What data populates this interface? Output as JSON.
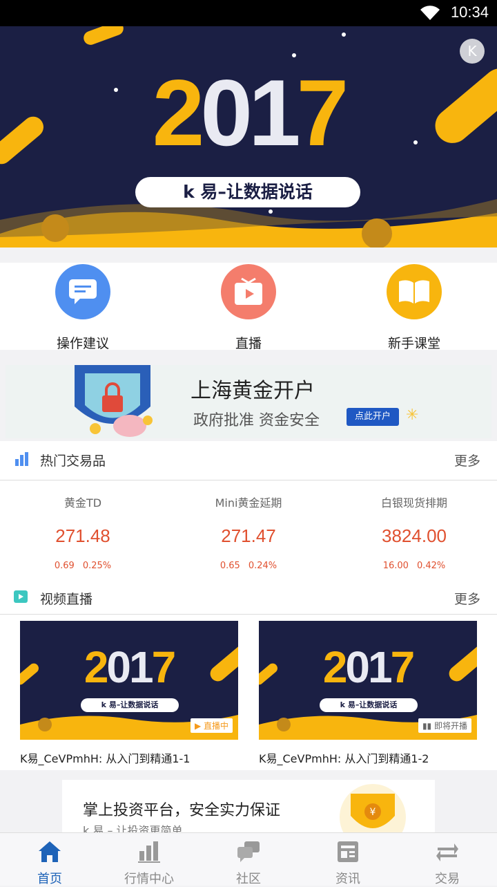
{
  "status": {
    "time": "10:34"
  },
  "hero": {
    "year_white": "20",
    "year_white2": "17",
    "slogan": "k 易–让数据说话"
  },
  "quick_actions": [
    {
      "label": "操作建议",
      "color": "#4f8ff0"
    },
    {
      "label": "直播",
      "color": "#f47d6c"
    },
    {
      "label": "新手课堂",
      "color": "#f8b50e"
    }
  ],
  "ad_banner": {
    "title": "上海黄金开户",
    "subtitle": "政府批准  资金安全",
    "button": "点此开户"
  },
  "hot": {
    "title": "热门交易品",
    "more": "更多",
    "items": [
      {
        "name": "黄金TD",
        "price": "271.48",
        "change": "0.69",
        "percent": "0.25%"
      },
      {
        "name": "Mini黄金延期",
        "price": "271.47",
        "change": "0.65",
        "percent": "0.24%"
      },
      {
        "name": "白银现货排期",
        "price": "3824.00",
        "change": "16.00",
        "percent": "0.42%"
      }
    ]
  },
  "videos": {
    "title": "视频直播",
    "more": "更多",
    "items": [
      {
        "title": "K易_CeVPmhH: 从入门到精通1-1",
        "badge": "直播中",
        "pill": "k 易–让数据说话"
      },
      {
        "title": "K易_CeVPmhH: 从入门到精通1-2",
        "badge": "即将开播",
        "pill": "k 易–让数据说话"
      }
    ]
  },
  "promo": {
    "title": "掌上投资平台，安全实力保证",
    "subtitle": "k 易 – 让投资更简单"
  },
  "nav": [
    {
      "label": "首页",
      "active": true
    },
    {
      "label": "行情中心"
    },
    {
      "label": "社区"
    },
    {
      "label": "资讯"
    },
    {
      "label": "交易"
    }
  ]
}
